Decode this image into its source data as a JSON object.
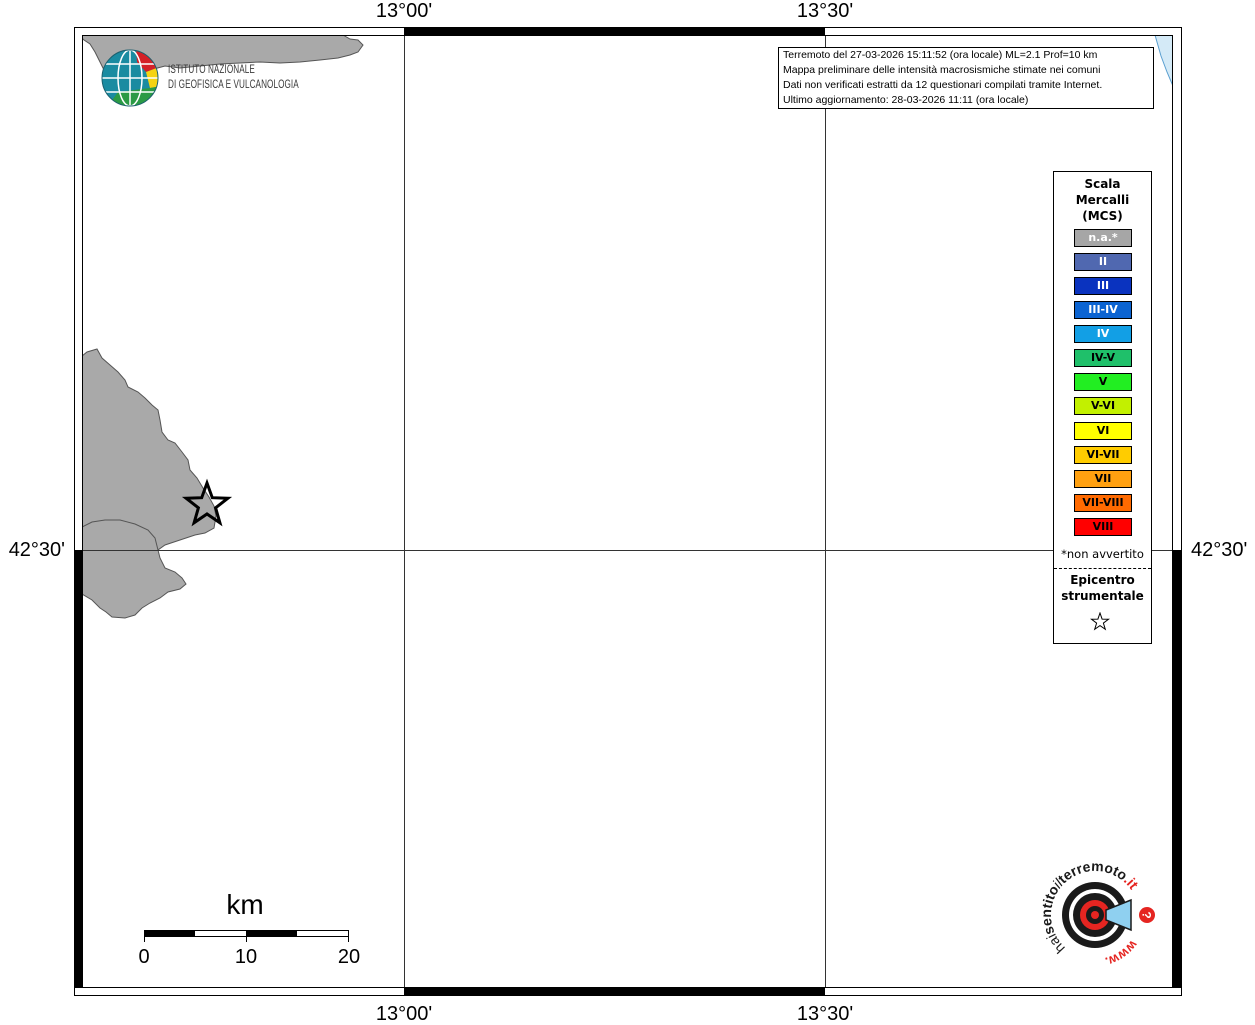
{
  "map": {
    "grid_labels": {
      "top": [
        "13°00'",
        "13°30'"
      ],
      "bottom": [
        "13°00'",
        "13°30'"
      ],
      "left": "42°30'",
      "right": "42°30'"
    },
    "colors": {
      "land": "#a9a9a9",
      "land_outline": "#555555",
      "sea": "#d4eaf7",
      "sea_outline": "#5a9fd0"
    }
  },
  "ingv_logo": {
    "line1": "ISTITUTO NAZIONALE",
    "line2": "DI GEOFISICA E VULCANOLOGIA"
  },
  "info_box": {
    "lines": [
      "Terremoto del 27-03-2026 15:11:52 (ora locale) ML=2.1 Prof=10 km",
      "Mappa preliminare delle intensità macrosismiche stimate nei comuni",
      "Dati non verificati estratti da 12 questionari compilati tramite Internet.",
      "Ultimo aggiornamento: 28-03-2026 11:11 (ora locale)"
    ]
  },
  "legend": {
    "title": [
      "Scala",
      "Mercalli",
      "(MCS)"
    ],
    "items": [
      {
        "label": "n.a.*",
        "color": "#a6a6a6",
        "text_color": "#ffffff"
      },
      {
        "label": "II",
        "color": "#5068b0",
        "text_color": "#ffffff"
      },
      {
        "label": "III",
        "color": "#0a33bf",
        "text_color": "#ffffff"
      },
      {
        "label": "III-IV",
        "color": "#0b64d2",
        "text_color": "#ffffff"
      },
      {
        "label": "IV",
        "color": "#129fe5",
        "text_color": "#ffffff"
      },
      {
        "label": "IV-V",
        "color": "#1fc06a",
        "text_color": "#000000"
      },
      {
        "label": "V",
        "color": "#22ee22",
        "text_color": "#000000"
      },
      {
        "label": "V-VI",
        "color": "#c2f000",
        "text_color": "#000000"
      },
      {
        "label": "VI",
        "color": "#ffff00",
        "text_color": "#000000"
      },
      {
        "label": "VI-VII",
        "color": "#ffcc00",
        "text_color": "#000000"
      },
      {
        "label": "VII",
        "color": "#ffa010",
        "text_color": "#000000"
      },
      {
        "label": "VII-VIII",
        "color": "#ff6a00",
        "text_color": "#000000"
      },
      {
        "label": "VIII",
        "color": "#ff0000",
        "text_color": "#000000"
      }
    ],
    "footnote": "*non avvertito",
    "epicenter_title": [
      "Epicentro",
      "strumentale"
    ]
  },
  "scale_bar": {
    "unit": "km",
    "tick_labels": [
      "0",
      "10",
      "20"
    ]
  },
  "hsit_logo": {
    "prefix": "www.",
    "hai": "hai",
    "sentito": "sentito",
    "il": "il",
    "terremoto": "terremoto",
    "suffix": ".it",
    "question": "?"
  }
}
